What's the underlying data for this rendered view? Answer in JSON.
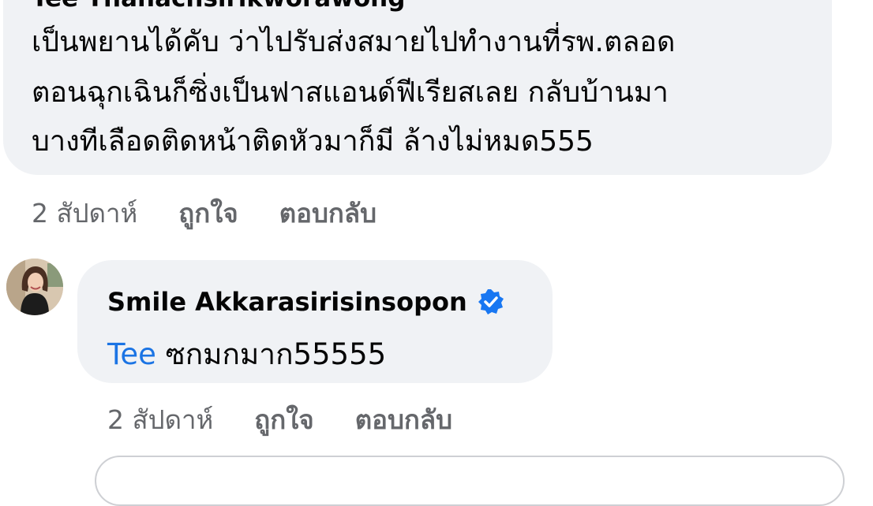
{
  "top_comment": {
    "author": "Tee Thanachsirikworawong",
    "lines": [
      "เป็นพยานได้คับ ว่าไปรับส่งสมายไปทำงานที่รพ.ตลอด",
      "ตอนฉุกเฉินก็ซิ่งเป็นฟาสแอนด์ฟีเรียสเลย กลับบ้านมา",
      "บางทีเลือดติดหน้าติดหัวมาก็มี ล้างไม่หมด555"
    ],
    "time": "2 สัปดาห์",
    "like_label": "ถูกใจ",
    "reply_label": "ตอบกลับ"
  },
  "reply_comment": {
    "author": "Smile Akkarasirisinsopon",
    "verified_icon": "verified-badge-icon",
    "mention": "Tee",
    "text": " ซกมกมาก55555",
    "time": "2 สัปดาห์",
    "like_label": "ถูกใจ",
    "reply_label": "ตอบกลับ"
  },
  "colors": {
    "bubble": "#f0f2f5",
    "meta": "#65676b",
    "mention": "#1b74e4",
    "verified": "#1877f2"
  }
}
